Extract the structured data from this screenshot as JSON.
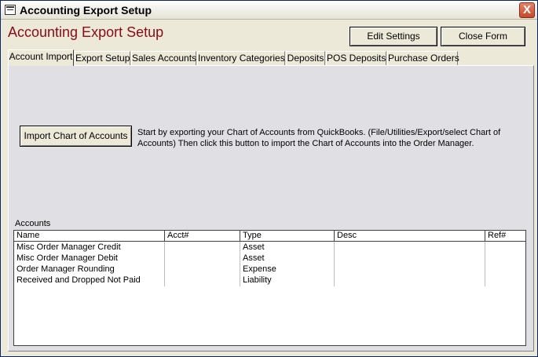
{
  "window": {
    "title": "Accounting Export Setup",
    "close_glyph": "X",
    "icon": "form-icon"
  },
  "header": {
    "title": "Accounting Export Setup",
    "title_color": "#8b0a14",
    "edit_settings_label": "Edit Settings",
    "close_form_label": "Close Form"
  },
  "tabs": [
    {
      "label": "Account Import",
      "active": true
    },
    {
      "label": "Export Setup"
    },
    {
      "label": "Sales Accounts"
    },
    {
      "label": "Inventory Categories"
    },
    {
      "label": "Deposits"
    },
    {
      "label": "POS Deposits"
    },
    {
      "label": "Purchase Orders"
    }
  ],
  "import": {
    "button_label": "Import Chart of Accounts",
    "instructions": "Start by exporting your Chart of Accounts from QuickBooks. (File/Utilities/Export/select Chart of Accounts) Then click this button to import the Chart of Accounts into the Order Manager."
  },
  "accounts": {
    "label": "Accounts",
    "columns": [
      "Name",
      "Acct#",
      "Type",
      "Desc",
      "Ref#"
    ],
    "rows": [
      {
        "name": "Misc Order Manager Credit",
        "acct": "",
        "type": "Asset",
        "desc": "",
        "ref": ""
      },
      {
        "name": "Misc Order Manager Debit",
        "acct": "",
        "type": "Asset",
        "desc": "",
        "ref": ""
      },
      {
        "name": "Order Manager Rounding",
        "acct": "",
        "type": "Expense",
        "desc": "",
        "ref": ""
      },
      {
        "name": "Received and Dropped Not Paid",
        "acct": "",
        "type": "Liability",
        "desc": "",
        "ref": ""
      }
    ]
  }
}
